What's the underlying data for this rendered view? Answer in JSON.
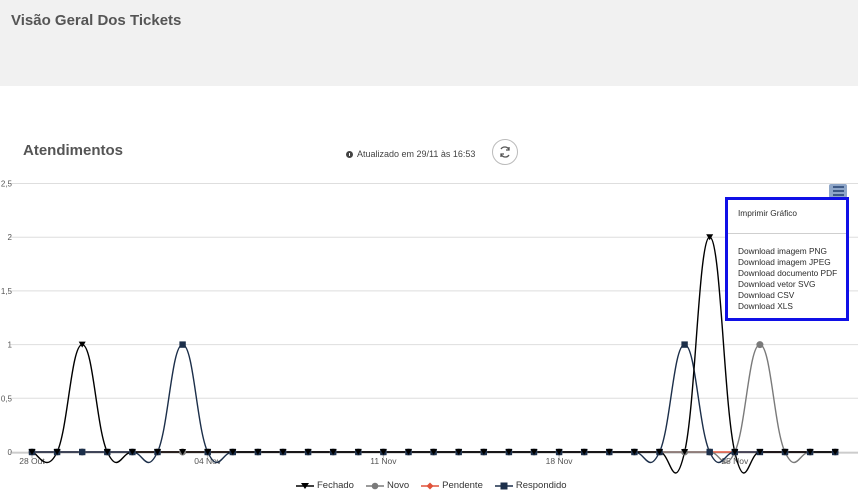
{
  "page": {
    "title": "Visão Geral Dos Tickets"
  },
  "card": {
    "title": "Atendimentos",
    "updated_text": "Atualizado em 29/11 às 16:53",
    "refresh_icon": "refresh-icon"
  },
  "menu": {
    "icon": "hamburger-menu-icon",
    "items": [
      "Imprimir Gráfico",
      "Download imagem PNG",
      "Download imagem JPEG",
      "Download documento PDF",
      "Download vetor SVG",
      "Download CSV",
      "Download XLS"
    ]
  },
  "chart_data": {
    "type": "line",
    "ylim": [
      0,
      2.5
    ],
    "yticks": [
      0,
      0.5,
      1,
      1.5,
      2,
      2.5
    ],
    "ytick_labels": [
      "0",
      "0,5",
      "1",
      "1,5",
      "2",
      "2,5"
    ],
    "x": [
      "28 Out",
      "29 Out",
      "30 Out",
      "31 Out",
      "01 Nov",
      "02 Nov",
      "03 Nov",
      "04 Nov",
      "05 Nov",
      "06 Nov",
      "07 Nov",
      "08 Nov",
      "09 Nov",
      "10 Nov",
      "11 Nov",
      "12 Nov",
      "13 Nov",
      "14 Nov",
      "15 Nov",
      "16 Nov",
      "17 Nov",
      "18 Nov",
      "19 Nov",
      "20 Nov",
      "21 Nov",
      "22 Nov",
      "23 Nov",
      "24 Nov",
      "25 Nov",
      "26 Nov",
      "27 Nov",
      "28 Nov",
      "29 Nov"
    ],
    "xtick_labels": [
      "28 Out",
      "04 Nov",
      "11 Nov",
      "18 Nov",
      "25 Nov"
    ],
    "series": [
      {
        "name": "Fechado",
        "color": "#000000",
        "marker": "triangle-down",
        "values": [
          0,
          0,
          1,
          0,
          0,
          0,
          0,
          0,
          0,
          0,
          0,
          0,
          0,
          0,
          0,
          0,
          0,
          0,
          0,
          0,
          0,
          0,
          0,
          0,
          0,
          0,
          0,
          2,
          0,
          0,
          0,
          0,
          0
        ]
      },
      {
        "name": "Novo",
        "color": "#7a7a7a",
        "marker": "circle",
        "values": [
          0,
          0,
          0,
          0,
          0,
          0,
          0,
          0,
          0,
          0,
          0,
          0,
          0,
          0,
          0,
          0,
          0,
          0,
          0,
          0,
          0,
          0,
          0,
          0,
          0,
          0,
          0,
          0,
          0,
          1,
          0,
          0,
          0
        ]
      },
      {
        "name": "Pendente",
        "color": "#e0523a",
        "marker": "diamond",
        "values": [
          0,
          0,
          0,
          0,
          0,
          0,
          0,
          0,
          0,
          0,
          0,
          0,
          0,
          0,
          0,
          0,
          0,
          0,
          0,
          0,
          0,
          0,
          0,
          0,
          0,
          0,
          0,
          0,
          0,
          0,
          0,
          0,
          0
        ]
      },
      {
        "name": "Respondido",
        "color": "#1c2f4a",
        "marker": "square",
        "values": [
          0,
          0,
          0,
          0,
          0,
          0,
          1,
          0,
          0,
          0,
          0,
          0,
          0,
          0,
          0,
          0,
          0,
          0,
          0,
          0,
          0,
          0,
          0,
          0,
          0,
          0,
          1,
          0,
          0,
          0,
          0,
          0,
          0
        ]
      }
    ],
    "legend": "bottom-center",
    "grid": true
  }
}
